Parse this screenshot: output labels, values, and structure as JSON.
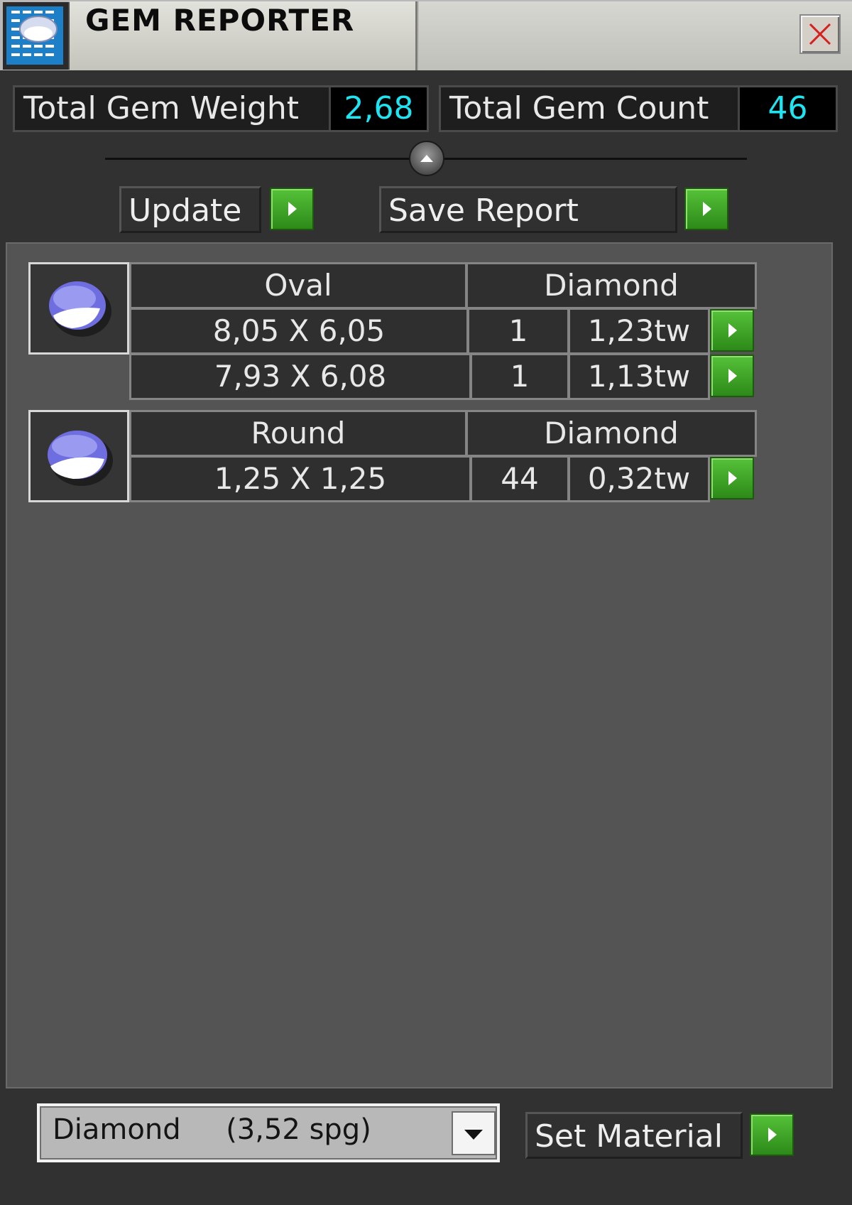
{
  "window": {
    "title": "GEM REPORTER"
  },
  "icons": {
    "app": "gem-reporter-app-icon",
    "close": "close-x-icon",
    "gem": "gem-icon",
    "play": "play-arrow-icon",
    "dropdown": "chevron-down-icon"
  },
  "stats": {
    "weight": {
      "label": "Total Gem Weight",
      "value": "2,68"
    },
    "count": {
      "label": "Total Gem Count",
      "value": "46"
    }
  },
  "actions": {
    "update": "Update",
    "save_report": "Save Report"
  },
  "groups": [
    {
      "shape": "Oval",
      "material": "Diamond",
      "rows": [
        {
          "size": "8,05 X 6,05",
          "count": "1",
          "weight": "1,23tw"
        },
        {
          "size": "7,93 X 6,08",
          "count": "1",
          "weight": "1,13tw"
        }
      ]
    },
    {
      "shape": "Round",
      "material": "Diamond",
      "rows": [
        {
          "size": "1,25 X 1,25",
          "count": "44",
          "weight": "0,32tw"
        }
      ]
    }
  ],
  "material_select": {
    "name": "Diamond",
    "density": "(3,52 spg)"
  },
  "set_material": "Set Material",
  "colors": {
    "accent_value": "#1fe4f2",
    "go_button": "#3fa325",
    "close_x": "#d42020"
  }
}
